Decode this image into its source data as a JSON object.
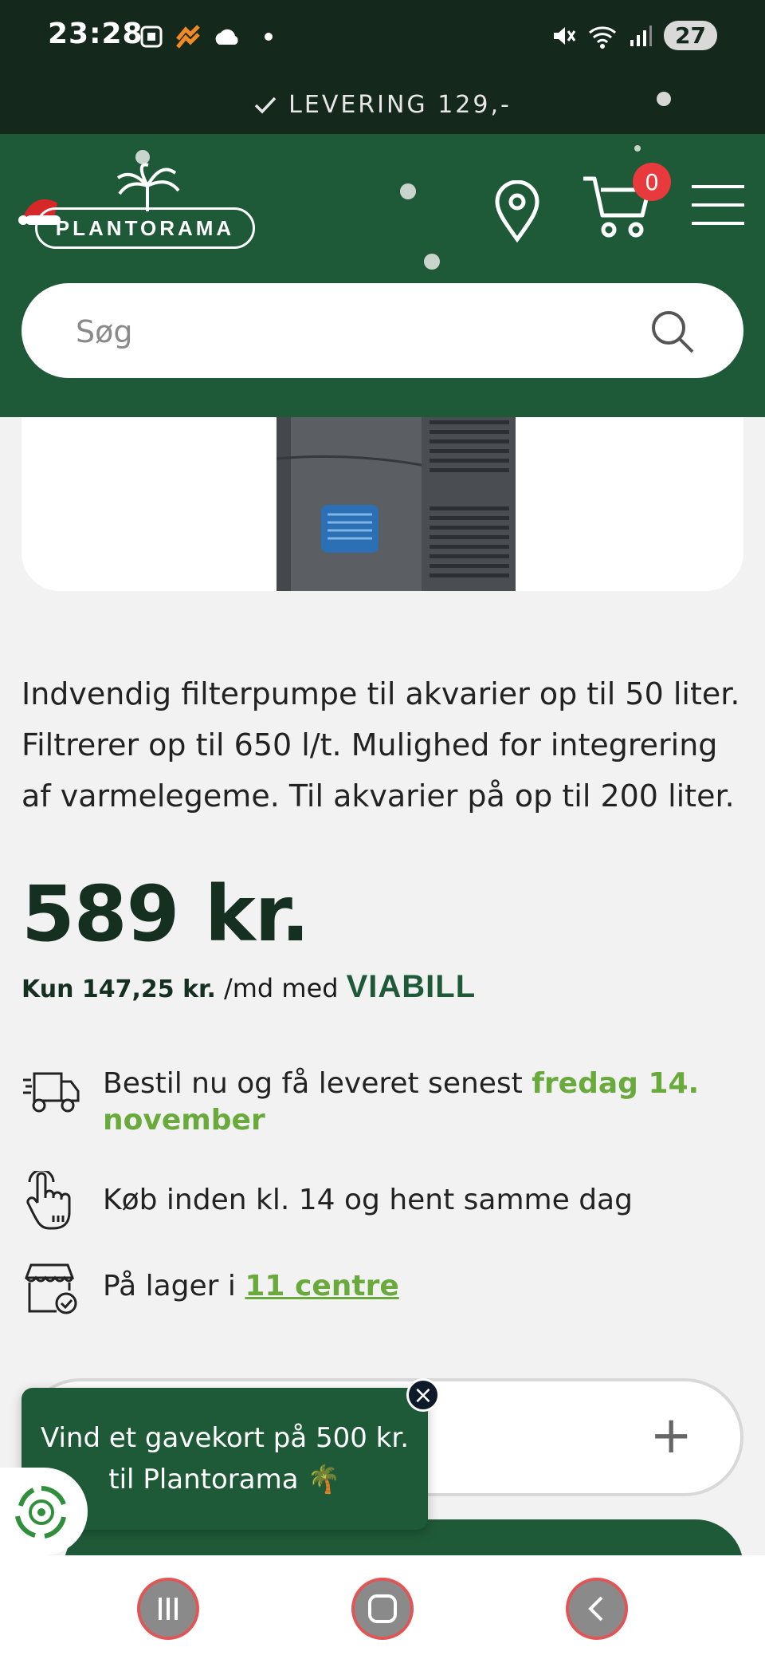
{
  "status_bar": {
    "time": "23:28",
    "battery": "27",
    "icons_left": [
      "screenshot-icon",
      "app-notification-icon",
      "cloud-icon",
      "dot-icon"
    ],
    "icons_right": [
      "mute-icon",
      "wifi-icon",
      "signal-icon"
    ]
  },
  "delivery_strip": {
    "text": "LEVERING 129,-"
  },
  "header": {
    "logo_text": "PLANTORAMA",
    "cart_count": "0",
    "search_placeholder": "Søg"
  },
  "product": {
    "description": "Indvendig filterpumpe til akvarier op til 50 liter. Filtrerer op til 650 l/t. Mulighed for integrering af varmelegeme. Til akvarier på op til 200 liter.",
    "price": "589 kr.",
    "viabill_amount": "Kun 147,25 kr.",
    "viabill_suffix": "/md med",
    "viabill_logo": "VIABILL"
  },
  "info": {
    "delivery_text": "Bestil nu og få leveret senest",
    "delivery_date": "fredag 14. november",
    "pickup_text": "Køb inden kl. 14 og hent samme dag",
    "stock_text": "På lager i",
    "stock_link": "11 centre"
  },
  "quantity": {
    "plus": "+"
  },
  "popup": {
    "line1": "Vind et gavekort på 500 kr.",
    "line2": "til Plantorama 🌴",
    "close": "×"
  },
  "colors": {
    "header_green": "#1f5a38",
    "dark_green": "#15281c",
    "accent_green": "#6aaa3c",
    "badge_red": "#e8393d"
  }
}
